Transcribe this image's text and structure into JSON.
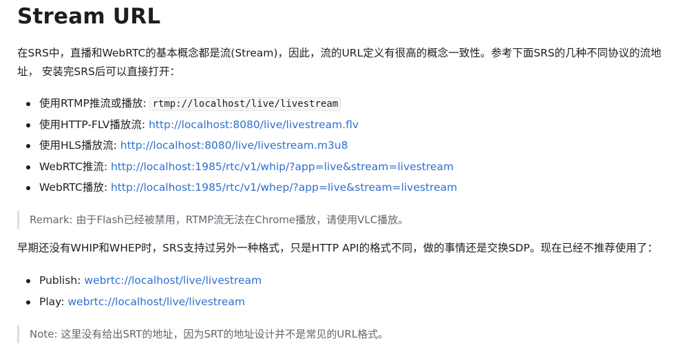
{
  "heading": "Stream URL",
  "intro": "在SRS中，直播和WebRTC的基本概念都是流(Stream)，因此，流的URL定义有很高的概念一致性。参考下面SRS的几种不同协议的流地址， 安装完SRS后可以直接打开：",
  "primary_list": [
    {
      "label": "使用RTMP推流或播放: ",
      "code": "rtmp://localhost/live/livestream"
    },
    {
      "label": "使用HTTP-FLV播放流: ",
      "link": "http://localhost:8080/live/livestream.flv"
    },
    {
      "label": "使用HLS播放流: ",
      "link": "http://localhost:8080/live/livestream.m3u8"
    },
    {
      "label": "WebRTC推流: ",
      "link": "http://localhost:1985/rtc/v1/whip/?app=live&stream=livestream"
    },
    {
      "label": "WebRTC播放: ",
      "link": "http://localhost:1985/rtc/v1/whep/?app=live&stream=livestream"
    }
  ],
  "remark": "Remark: 由于Flash已经被禁用，RTMP流无法在Chrome播放，请使用VLC播放。",
  "legacy_paragraph": "早期还没有WHIP和WHEP时，SRS支持过另外一种格式，只是HTTP API的格式不同，做的事情还是交换SDP。现在已经不推荐使用了：",
  "legacy_list": [
    {
      "label": "Publish: ",
      "link": "webrtc://localhost/live/livestream"
    },
    {
      "label": "Play: ",
      "link": "webrtc://localhost/live/livestream"
    }
  ],
  "note": "Note: 这里没有给出SRT的地址，因为SRT的地址设计并不是常见的URL格式。",
  "colors": {
    "text": "#1c1e21",
    "link": "#2e6fcf",
    "quote_text": "#606770",
    "quote_border": "#dadde1"
  }
}
